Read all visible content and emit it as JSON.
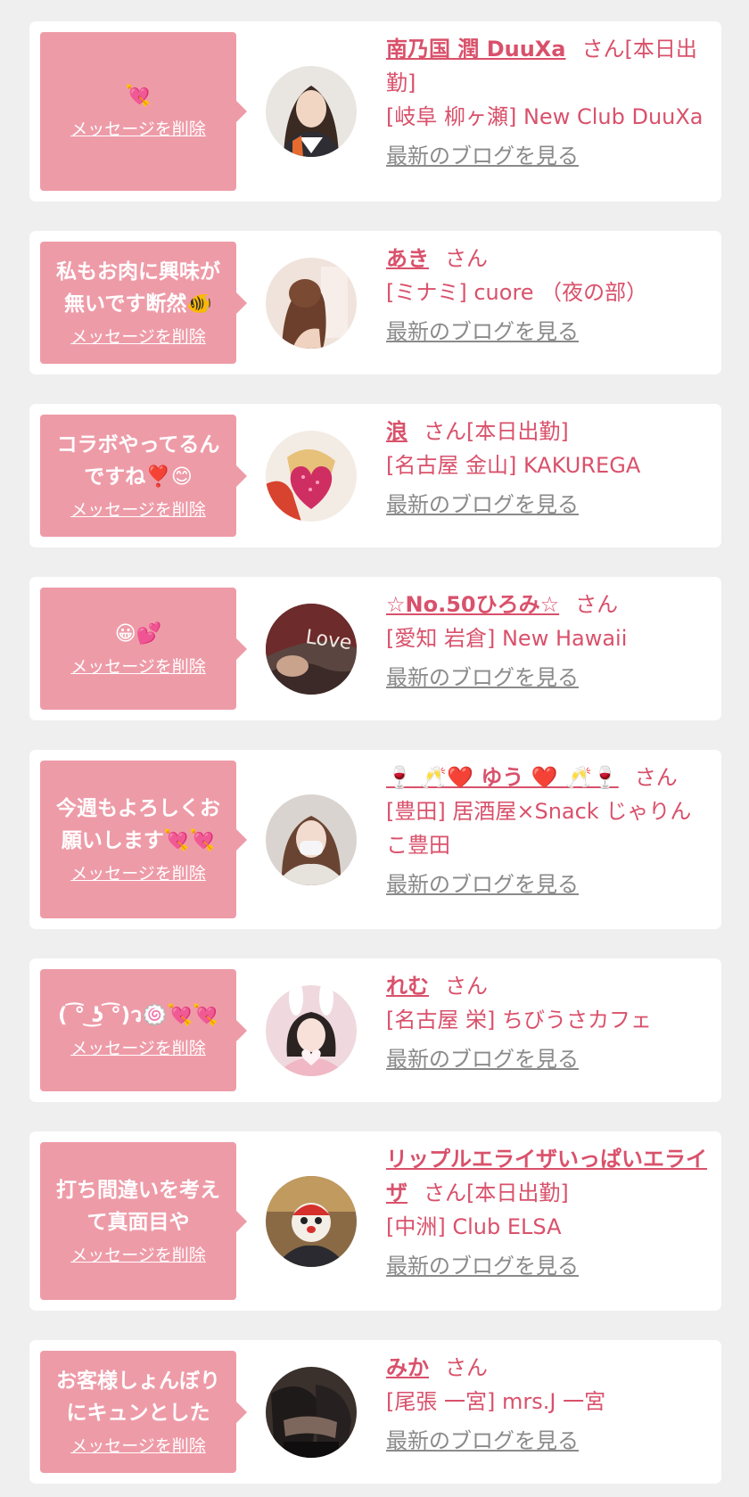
{
  "delete_label": "メッセージを削除",
  "blog_label": "最新のブログを見る",
  "colors": {
    "bubble": "#ee9ba8",
    "accent": "#d9516b",
    "link_gray": "#8a8a8a",
    "background": "#efefef"
  },
  "items": [
    {
      "message": "💘",
      "name": "南乃国 潤 DuuXa",
      "suffix": "さん[本日出勤]",
      "shop": "[岐阜 柳ヶ瀬] New Club DuuXa",
      "avatar": "avatar-woman-suit"
    },
    {
      "message": "私もお肉に興味が無いです断然🐠",
      "name": "あき",
      "suffix": "さん",
      "shop": "[ミナミ] cuore （夜の部）",
      "avatar": "avatar-woman-hair"
    },
    {
      "message": "コラボやってるんですね❣️😊",
      "name": "浪",
      "suffix": "さん[本日出勤]",
      "shop": "[名古屋 金山] KAKUREGA",
      "avatar": "avatar-heart-sticker"
    },
    {
      "message": "😀💕",
      "name": "☆No.50ひろみ☆",
      "suffix": "さん",
      "shop": "[愛知 岩倉] New Hawaii",
      "avatar": "avatar-love-sign"
    },
    {
      "message": "今週もよろしくお願いします💘💘",
      "name": "🍷 🥂❤️ ゆう ❤️ 🥂🍷",
      "suffix": "さん",
      "shop": "[豊田] 居酒屋×Snack じゃりんこ豊田",
      "avatar": "avatar-woman-mask"
    },
    {
      "message": "( ͡° ͜ʖ ͡°)ว🍥💘💘",
      "name": "れむ",
      "suffix": "さん",
      "shop": "[名古屋 栄] ちびうさカフェ",
      "avatar": "avatar-bunny-ears"
    },
    {
      "message": "打ち間違いを考えて真面目や",
      "name": "リップルエライザいっぱいエライザ",
      "suffix": "さん[本日出勤]",
      "shop": "[中洲] Club ELSA",
      "avatar": "avatar-mask-character"
    },
    {
      "message": "お客様しょんぼりにキュンとした",
      "name": "みか",
      "suffix": "さん",
      "shop": "[尾張 一宮] mrs.J 一宮",
      "avatar": "avatar-legs-stockings"
    }
  ]
}
